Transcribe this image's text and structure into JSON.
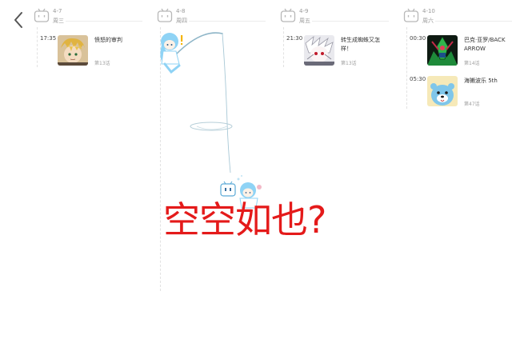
{
  "nav": {
    "back_icon": "chevron-left-icon"
  },
  "days": [
    {
      "date": "4-7",
      "weekday": "周三",
      "entries": [
        {
          "time": "17:35",
          "title": "愤怒的审判",
          "episode": "第13话",
          "cover_color": "#c9a064"
        }
      ]
    },
    {
      "date": "4-8",
      "weekday": "周四",
      "entries": []
    },
    {
      "date": "4-9",
      "weekday": "周五",
      "entries": [
        {
          "time": "21:30",
          "title": "转生成蜘蛛又怎样！",
          "episode": "第13话",
          "cover_color": "#d8d8dc"
        }
      ]
    },
    {
      "date": "4-10",
      "weekday": "周六",
      "entries": [
        {
          "time": "00:30",
          "title": "巴克·亚罗/BACK ARROW",
          "episode": "第14话",
          "cover_color": "#2f7a2f"
        },
        {
          "time": "05:30",
          "title": "海獭波乐 5th",
          "episode": "第47话",
          "cover_color": "#7fc6ea"
        }
      ]
    }
  ],
  "empty_state": {
    "message": "空空如也?"
  },
  "colors": {
    "accent_red": "#e41a1a",
    "muted_text": "#9a9a9a",
    "tv_icon_gray": "#b8b8b8",
    "mascot_blue": "#8fd3f5"
  }
}
